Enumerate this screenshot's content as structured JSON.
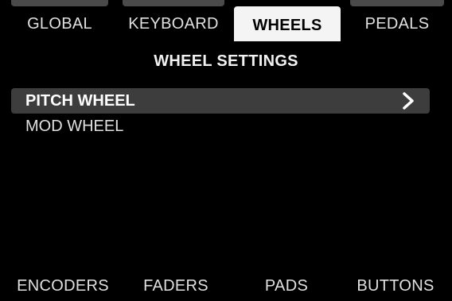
{
  "top_tabs": [
    {
      "label": "GLOBAL",
      "active": false
    },
    {
      "label": "KEYBOARD",
      "active": false
    },
    {
      "label": "WHEELS",
      "active": true
    },
    {
      "label": "PEDALS",
      "active": false
    }
  ],
  "header": {
    "title": "WHEEL SETTINGS"
  },
  "menu": {
    "items": [
      {
        "label": "PITCH WHEEL",
        "selected": true,
        "icon": "chevron-right-icon"
      },
      {
        "label": "MOD WHEEL",
        "selected": false
      }
    ]
  },
  "bottom_tabs": [
    {
      "label": "ENCODERS"
    },
    {
      "label": "FADERS"
    },
    {
      "label": "PADS"
    },
    {
      "label": "BUTTONS"
    }
  ],
  "colors": {
    "background": "#000000",
    "active_tab": "#f4f4f4",
    "tab_cap": "#4a4a4a",
    "selected_row": "#3d3d3d",
    "text": "#e0e0e0"
  }
}
